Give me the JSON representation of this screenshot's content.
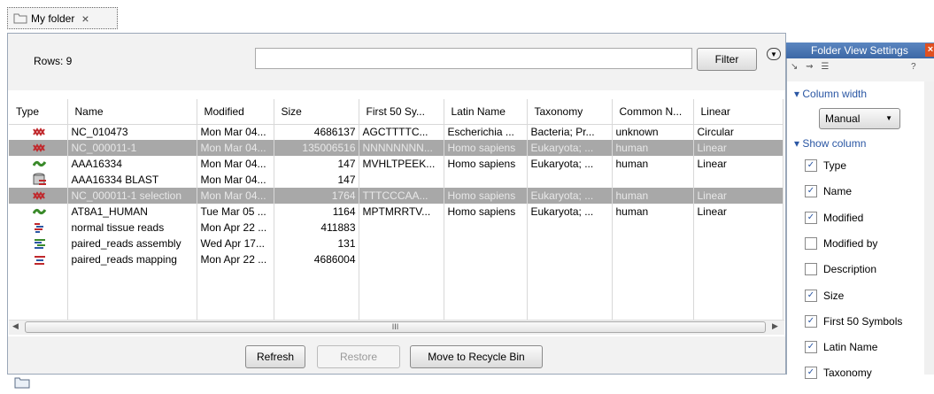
{
  "tab": {
    "title": "My folder",
    "close": "×"
  },
  "toolbar": {
    "rows_label": "Rows: 9",
    "filter_value": "",
    "filter_button": "Filter"
  },
  "table": {
    "columns": [
      "Type",
      "Name",
      "Modified",
      "Size",
      "First 50 Sy...",
      "Latin Name",
      "Taxonomy",
      "Common N...",
      "Linear"
    ],
    "rows": [
      {
        "type": "sequence-red-icon",
        "name": "NC_010473",
        "modified": "Mon Mar 04...",
        "size": "4686137",
        "first50": "AGCTTTTC...",
        "latin": "Escherichia ...",
        "taxonomy": "Bacteria; Pr...",
        "common": "unknown",
        "linear": "Circular",
        "selected": false
      },
      {
        "type": "sequence-red-icon",
        "name": "NC_000011-1",
        "modified": "Mon Mar 04...",
        "size": "135006516",
        "first50": "NNNNNNNN...",
        "latin": "Homo sapiens",
        "taxonomy": "Eukaryota; ...",
        "common": "human",
        "linear": "Linear",
        "selected": true
      },
      {
        "type": "protein-green-icon",
        "name": "AAA16334",
        "modified": "Mon Mar 04...",
        "size": "147",
        "first50": "MVHLTPEEK...",
        "latin": "Homo sapiens",
        "taxonomy": "Eukaryota; ...",
        "common": "human",
        "linear": "Linear",
        "selected": false
      },
      {
        "type": "blast-database-icon",
        "name": "AAA16334 BLAST",
        "modified": "Mon Mar 04...",
        "size": "147",
        "first50": "",
        "latin": "",
        "taxonomy": "",
        "common": "",
        "linear": "",
        "selected": false
      },
      {
        "type": "sequence-red-icon",
        "name": "NC_000011-1 selection",
        "modified": "Mon Mar 04...",
        "size": "1764",
        "first50": "TTTCCCAA...",
        "latin": "Homo sapiens",
        "taxonomy": "Eukaryota; ...",
        "common": "human",
        "linear": "Linear",
        "selected": true
      },
      {
        "type": "protein-green-icon",
        "name": "AT8A1_HUMAN",
        "modified": "Tue Mar 05 ...",
        "size": "1164",
        "first50": "MPTMRRTV...",
        "latin": "Homo sapiens",
        "taxonomy": "Eukaryota; ...",
        "common": "human",
        "linear": "Linear",
        "selected": false
      },
      {
        "type": "reads-icon",
        "name": "normal tissue reads",
        "modified": "Mon Apr 22 ...",
        "size": "411883",
        "first50": "",
        "latin": "",
        "taxonomy": "",
        "common": "",
        "linear": "",
        "selected": false
      },
      {
        "type": "assembly-icon",
        "name": "paired_reads assembly",
        "modified": "Wed Apr 17...",
        "size": "131",
        "first50": "",
        "latin": "",
        "taxonomy": "",
        "common": "",
        "linear": "",
        "selected": false
      },
      {
        "type": "mapping-icon",
        "name": "paired_reads mapping",
        "modified": "Mon Apr 22 ...",
        "size": "4686004",
        "first50": "",
        "latin": "",
        "taxonomy": "",
        "common": "",
        "linear": "",
        "selected": false
      }
    ]
  },
  "scroll": {
    "grip": "III"
  },
  "buttons": {
    "refresh": "Refresh",
    "restore": "Restore",
    "recycle": "Move to Recycle Bin"
  },
  "side": {
    "title": "Folder View Settings",
    "help": "?",
    "column_width_label": "Column width",
    "column_width_value": "Manual",
    "show_column_label": "Show column",
    "columns": [
      {
        "label": "Type",
        "checked": true
      },
      {
        "label": "Name",
        "checked": true
      },
      {
        "label": "Modified",
        "checked": true
      },
      {
        "label": "Modified by",
        "checked": false
      },
      {
        "label": "Description",
        "checked": false
      },
      {
        "label": "Size",
        "checked": true
      },
      {
        "label": "First 50 Symbols",
        "checked": true
      },
      {
        "label": "Latin Name",
        "checked": true
      },
      {
        "label": "Taxonomy",
        "checked": true
      }
    ]
  },
  "colors": {
    "selected_row": "#a8a8a8",
    "accent": "#2b57a4",
    "close_red": "#e05020",
    "icon_red": "#c0282c",
    "icon_green": "#3a8a2a"
  }
}
